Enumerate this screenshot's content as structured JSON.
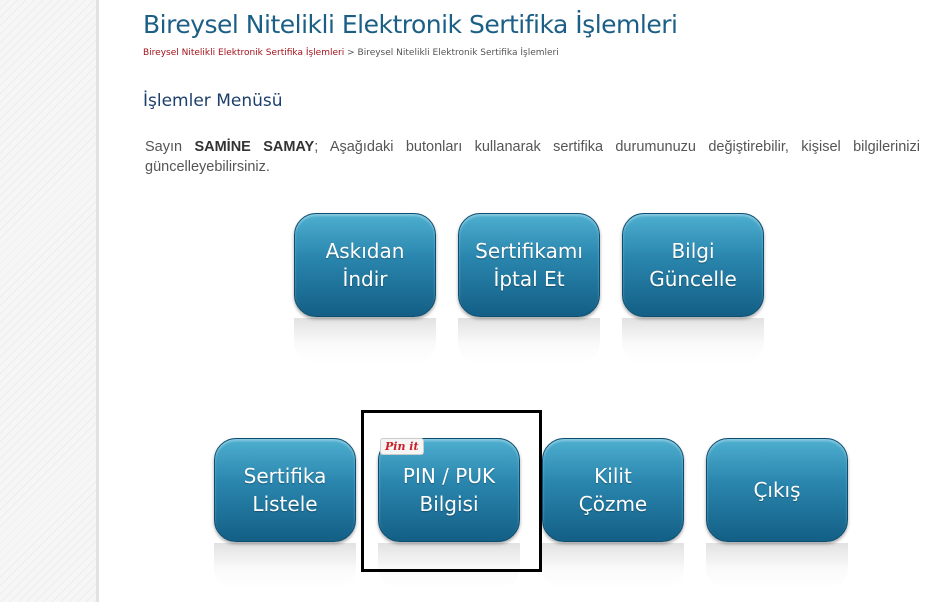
{
  "header": {
    "title": "Bireysel Nitelikli Elektronik Sertifika İşlemleri",
    "breadcrumb": {
      "link": "Bireysel Nitelikli Elektronik Sertifika İşlemleri",
      "separator": ">",
      "current": "Bireysel Nitelikli Elektronik Sertifika İşlemleri"
    }
  },
  "section": {
    "title": "İşlemler Menüsü",
    "intro_prefix": "Sayın",
    "user_name": "SAMİNE SAMAY",
    "intro_text": "; Aşağıdaki butonları kullanarak sertifika durumunuzu değiştirebilir, kişisel bilgilerinizi güncelleyebilirsiniz."
  },
  "buttons": {
    "askidan_indir": "Askıdan\nİndir",
    "sertifikami_iptal": "Sertifikamı\nİptal Et",
    "bilgi_guncelle": "Bilgi\nGüncelle",
    "sertifika_listele": "Sertifika\nListele",
    "pin_puk": "PIN / PUK\nBilgisi",
    "kilit_cozme": "Kilit\nÇözme",
    "cikis": "Çıkış"
  },
  "overlay": {
    "pin_it_label": "Pin it"
  },
  "colors": {
    "title": "#1c5f86",
    "breadcrumb_link": "#a5121a",
    "button_top": "#4eafd0",
    "button_bottom": "#135f86"
  }
}
